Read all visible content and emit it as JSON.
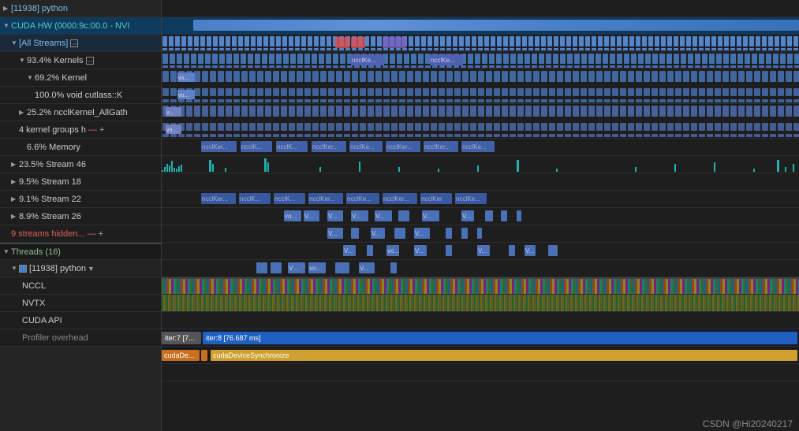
{
  "left": {
    "rows": [
      {
        "id": "python-row",
        "indent": 1,
        "triangle": "closed",
        "label": "[11938] python",
        "color": "blue",
        "type": "header"
      },
      {
        "id": "cuda-hw",
        "indent": 0,
        "triangle": "open",
        "label": "CUDA HW (0000:9c:00.0 - NVI",
        "color": "cyan",
        "type": "section"
      },
      {
        "id": "all-streams",
        "indent": 1,
        "triangle": "open",
        "label": "[All Streams]",
        "color": "blue",
        "type": "subsection",
        "expandIcon": true
      },
      {
        "id": "kernels-93",
        "indent": 2,
        "triangle": "open",
        "label": "93.4% Kernels",
        "color": "default",
        "type": "sub2",
        "expandIcon": true
      },
      {
        "id": "kernel-69",
        "indent": 3,
        "triangle": "open",
        "label": "69.2% Kernel",
        "color": "default",
        "type": "sub3"
      },
      {
        "id": "void-cutlass",
        "indent": 3,
        "triangle": "none",
        "label": "100.0% void cutlass::K",
        "color": "default",
        "type": "sub3"
      },
      {
        "id": "nccl-25",
        "indent": 2,
        "triangle": "closed",
        "label": "25.2% ncclKernel_AllGath",
        "color": "default",
        "type": "sub2"
      },
      {
        "id": "kernel-groups",
        "indent": 2,
        "triangle": "none",
        "label": "4 kernel groups h",
        "color": "red",
        "type": "kgroup"
      },
      {
        "id": "memory-6",
        "indent": 2,
        "triangle": "none",
        "label": "6.6% Memory",
        "color": "default",
        "type": "sub2"
      },
      {
        "id": "stream-46",
        "indent": 1,
        "triangle": "closed",
        "label": "23.5% Stream 46",
        "color": "default",
        "type": "stream"
      },
      {
        "id": "stream-18",
        "indent": 1,
        "triangle": "closed",
        "label": "9.5% Stream 18",
        "color": "default",
        "type": "stream"
      },
      {
        "id": "stream-22",
        "indent": 1,
        "triangle": "closed",
        "label": "9.1% Stream 22",
        "color": "default",
        "type": "stream"
      },
      {
        "id": "stream-26",
        "indent": 1,
        "triangle": "closed",
        "label": "8.9% Stream 26",
        "color": "default",
        "type": "stream"
      },
      {
        "id": "streams-hidden",
        "indent": 1,
        "triangle": "none",
        "label": "9 streams hidden...",
        "color": "red",
        "type": "hidden"
      },
      {
        "id": "threads-16",
        "indent": 0,
        "triangle": "open",
        "label": "Threads (16)",
        "color": "green",
        "type": "thread-header"
      },
      {
        "id": "python-thread",
        "indent": 1,
        "triangle": "open",
        "label": "[11938] python",
        "color": "default",
        "type": "thread-sub",
        "hasCheck": true
      },
      {
        "id": "nccl-label",
        "indent": 2,
        "triangle": "none",
        "label": "NCCL",
        "color": "default",
        "type": "thread-item"
      },
      {
        "id": "nvtx-label",
        "indent": 2,
        "triangle": "none",
        "label": "NVTX",
        "color": "default",
        "type": "thread-item"
      },
      {
        "id": "cuda-api-label",
        "indent": 2,
        "triangle": "none",
        "label": "CUDA API",
        "color": "default",
        "type": "thread-item"
      },
      {
        "id": "profiler-label",
        "indent": 2,
        "triangle": "none",
        "label": "Profiler overhead",
        "color": "default",
        "type": "profiler"
      }
    ]
  },
  "right": {
    "timeline_blocks": {
      "all_streams": "densely packed blue/purple blocks",
      "kernels": "medium blue blocks labeled V..., ncclKe...",
      "stream46": "ncclKer... blocks",
      "stream18": "V..., V... blocks",
      "stream22": "V..., V... blocks",
      "stream26": "V..., V... blocks"
    },
    "nvtx": {
      "left_label": "iter:7 [7...",
      "right_label": "iter:8 [76.687 ms]"
    },
    "cuda_api": {
      "left_label": "cudaDe...",
      "right_label": "cudaDeviceSynchronize"
    }
  },
  "watermark": "CSDN @Hi20240217",
  "colors": {
    "accent_blue": "#4a80c8",
    "accent_cyan": "#20b0b0",
    "accent_green": "#40a040",
    "section_bg": "#0e3a5e",
    "thread_bg": "#1a2a1a"
  }
}
